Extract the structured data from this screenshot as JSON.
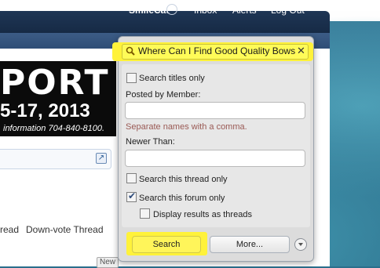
{
  "nav": {
    "user_label": "SmileCat",
    "inbox_label": "Inbox",
    "alerts_label": "Alerts",
    "logout_label": "Log Out"
  },
  "banner": {
    "title_fragment": "PORT",
    "dates": "5-17, 2013",
    "info": "information 704-840-8100."
  },
  "thread_links": {
    "read_fragment": "read",
    "downvote_label": "Down-vote Thread"
  },
  "new_badge": "New",
  "search_popup": {
    "query_value": "Where Can I Find Good Quality Bows",
    "titles_only_label": "Search titles only",
    "titles_only_checked": false,
    "posted_by_label": "Posted by Member:",
    "posted_by_value": "",
    "posted_by_hint": "Separate names with a comma.",
    "newer_than_label": "Newer Than:",
    "newer_than_value": "",
    "this_thread_label": "Search this thread only",
    "this_thread_checked": false,
    "this_forum_label": "Search this forum only",
    "this_forum_checked": true,
    "as_threads_label": "Display results as threads",
    "as_threads_checked": false,
    "search_button_label": "Search",
    "more_button_label": "More..."
  },
  "colors": {
    "navbar": "#1f3655",
    "highlight": "#fff23a",
    "hint_text": "#9a5a55"
  }
}
